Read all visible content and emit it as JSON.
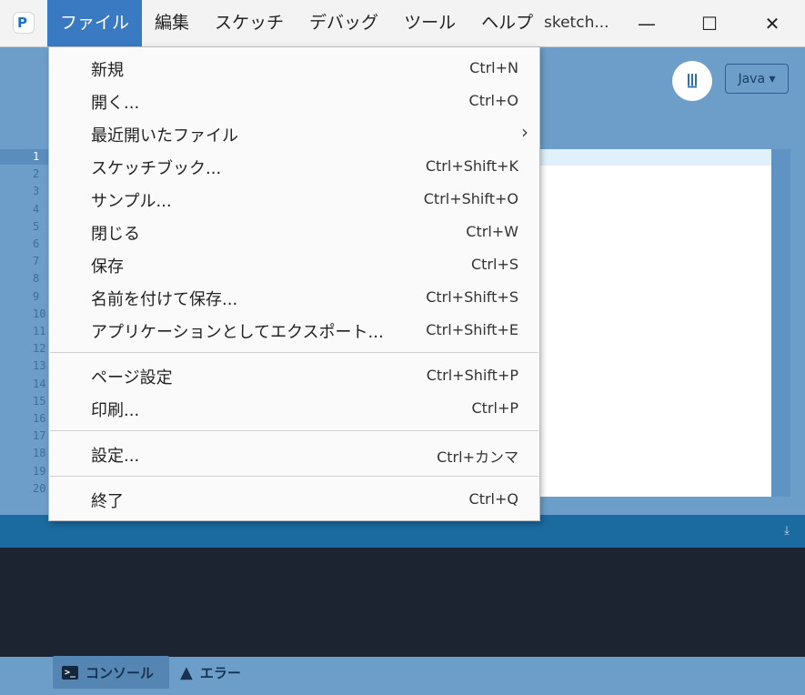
{
  "app": {
    "icon_glyph": "P",
    "window_title": "sketch..."
  },
  "menubar": [
    {
      "label": "ファイル",
      "active": true
    },
    {
      "label": "編集"
    },
    {
      "label": "スケッチ"
    },
    {
      "label": "デバッグ"
    },
    {
      "label": "ツール"
    },
    {
      "label": "ヘルプ"
    }
  ],
  "window_buttons": {
    "minimize": "—",
    "maximize": "☐",
    "close": "✕"
  },
  "toolbar": {
    "mode_icon": "butterfly-icon",
    "mode_glyph": "ꔗ",
    "mode_label": "Java ▾"
  },
  "editor": {
    "line_numbers": [
      "1",
      "2",
      "3",
      "4",
      "5",
      "6",
      "7",
      "8",
      "9",
      "10",
      "11",
      "12",
      "13",
      "14",
      "15",
      "16",
      "17",
      "18",
      "19",
      "20"
    ]
  },
  "file_menu": {
    "group1": [
      {
        "label": "新規",
        "shortcut": "Ctrl+N"
      },
      {
        "label": "開く...",
        "shortcut": "Ctrl+O"
      },
      {
        "label": "最近開いたファイル",
        "shortcut": "",
        "submenu": true
      },
      {
        "label": "スケッチブック...",
        "shortcut": "Ctrl+Shift+K"
      },
      {
        "label": "サンプル...",
        "shortcut": "Ctrl+Shift+O"
      },
      {
        "label": "閉じる",
        "shortcut": "Ctrl+W"
      },
      {
        "label": "保存",
        "shortcut": "Ctrl+S"
      },
      {
        "label": "名前を付けて保存...",
        "shortcut": "Ctrl+Shift+S"
      },
      {
        "label": "アプリケーションとしてエクスポート...",
        "shortcut": "Ctrl+Shift+E"
      }
    ],
    "group2": [
      {
        "label": "ページ設定",
        "shortcut": "Ctrl+Shift+P"
      },
      {
        "label": "印刷...",
        "shortcut": "Ctrl+P"
      }
    ],
    "group3": [
      {
        "label": "設定...",
        "shortcut": "Ctrl+カンマ"
      }
    ],
    "group4": [
      {
        "label": "終了",
        "shortcut": "Ctrl+Q"
      }
    ]
  },
  "footer": {
    "console_tab": "コンソール",
    "error_tab": "エラー",
    "console_icon": ">_",
    "warning_icon": "▲"
  },
  "colors": {
    "menu_active": "#3a7ac2",
    "toolbar_bg": "#6c9ec9",
    "console_bg": "#1b2430"
  }
}
